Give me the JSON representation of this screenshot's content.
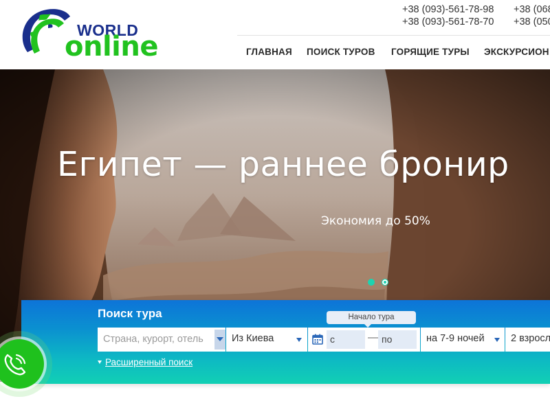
{
  "logo": {
    "world": "WORLD",
    "online": "online"
  },
  "header": {
    "phones": {
      "col1": [
        "+38 (093)-561-78-98",
        "+38 (093)-561-78-70"
      ],
      "col2": [
        "+38 (068",
        "+38 (050"
      ]
    },
    "nav": [
      "ГЛАВНАЯ",
      "ПОИСК ТУРОВ",
      "ГОРЯЩИЕ ТУРЫ",
      "ЭКСКУРСИОН"
    ]
  },
  "hero": {
    "title": "Египет — раннее бронир",
    "subtitle": "Экономия до 50%",
    "slides": {
      "count": 2,
      "active": 1
    }
  },
  "search": {
    "title": "Поиск тура",
    "country_placeholder": "Страна, курорт, отель",
    "from_value": "Из Киева",
    "date_start": "с",
    "date_separator": "—",
    "date_end": "по",
    "tooltip": "Начало тура",
    "nights_value": "на 7-9 ночей",
    "people_value": "2 взросл",
    "advanced_link": "Расширенный поиск"
  },
  "colors": {
    "brand_green": "#21c21f",
    "brand_blue": "#1a2f8c",
    "search_gradient_top": "#0d74d8",
    "search_gradient_bottom": "#12d0b4",
    "slider_dot": "#1dd3b0"
  },
  "icons": [
    "globe-logo-icon",
    "calendar-icon",
    "dropdown-caret-icon",
    "phone-call-icon"
  ]
}
